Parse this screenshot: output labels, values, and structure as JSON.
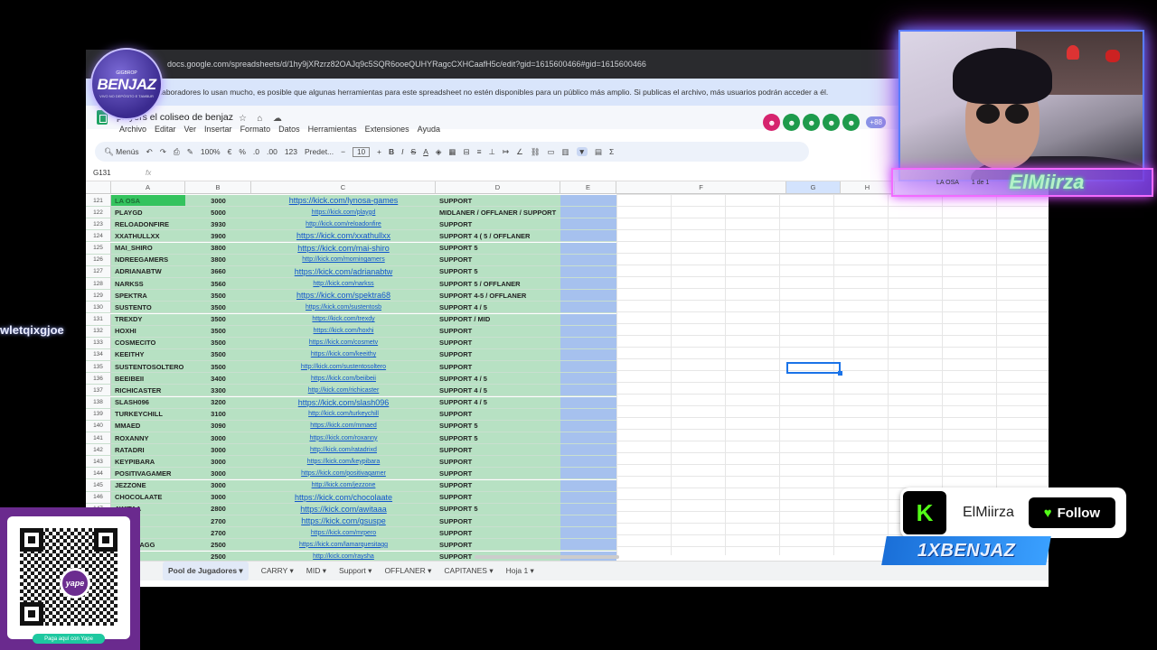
{
  "browser": {
    "url": "docs.google.com/spreadsheets/d/1hy9jXRzrz82OAJq9c5SQR6ooeQUHYRagcCXHCaafH5c/edit?gid=1615600466#gid=1615600466",
    "notice": "los colaboradores lo usan mucho, es posible que algunas herramientas para este spreadsheet no estén disponibles para un público más amplio. Si publicas el archivo, más usuarios podrán acceder a él."
  },
  "doc": {
    "title": "players el coliseo de benjaz",
    "menus": [
      "Archivo",
      "Editar",
      "Ver",
      "Insertar",
      "Formato",
      "Datos",
      "Herramientas",
      "Extensiones",
      "Ayuda"
    ],
    "collaborators_more": "+88"
  },
  "toolbar": {
    "search": "Menús",
    "zoom": "100%",
    "currency": "€",
    "percent": "%",
    "dec_less": ".0",
    "dec_more": ".00",
    "number_fmt": "123",
    "font": "Predet...",
    "font_size": "10"
  },
  "formula_bar": {
    "cell_ref": "G131",
    "fx": "fx"
  },
  "columns": [
    "A",
    "B",
    "C",
    "D",
    "E",
    "F",
    "G",
    "H"
  ],
  "rows": [
    {
      "n": "121",
      "a": "LA OSA",
      "b": "3000",
      "c": "https://kick.com/lynosa-games",
      "d": "SUPPORT"
    },
    {
      "n": "122",
      "a": "PLAYGD",
      "b": "5000",
      "c": "https://kick.com/playgd",
      "d": "MIDLANER / OFFLANER / SUPPORT"
    },
    {
      "n": "123",
      "a": "RELOADONFIRE",
      "b": "3930",
      "c": "http://kick.com/reloadonfire",
      "d": "SUPPORT"
    },
    {
      "n": "124",
      "a": "XXATHULLXX",
      "b": "3900",
      "c": "https://kick.com/xxathullxx",
      "d": "SUPPORT 4 ( 5 / OFFLANER"
    },
    {
      "n": "125",
      "a": "MAI_SHIRO",
      "b": "3800",
      "c": "https://kick.com/mai-shiro",
      "d": "SUPPORT 5"
    },
    {
      "n": "126",
      "a": "NDREEGAMERS",
      "b": "3800",
      "c": "http://kick.com/morningamers",
      "d": "SUPPORT"
    },
    {
      "n": "127",
      "a": "ADRIANABTW",
      "b": "3660",
      "c": "https://kick.com/adrianabtw",
      "d": "SUPPORT 5"
    },
    {
      "n": "128",
      "a": "NARKSS",
      "b": "3560",
      "c": "http://kick.com/narkss",
      "d": "SUPPORT 5 / OFFLANER"
    },
    {
      "n": "129",
      "a": "SPEKTRA",
      "b": "3500",
      "c": "https://kick.com/spektra68",
      "d": "SUPPORT 4-5 / OFFLANER"
    },
    {
      "n": "130",
      "a": "SUSTENTO",
      "b": "3500",
      "c": "https://kick.com/sustentosb",
      "d": "SUPPORT 4 / 5"
    },
    {
      "n": "131",
      "a": "TREXDY",
      "b": "3500",
      "c": "https://kick.com/trexdy",
      "d": "SUPPORT / MID"
    },
    {
      "n": "132",
      "a": "HOXHI",
      "b": "3500",
      "c": "https://kick.com/hoxhi",
      "d": "SUPPORT"
    },
    {
      "n": "133",
      "a": "COSMECITO",
      "b": "3500",
      "c": "https://kick.com/cosmetv",
      "d": "SUPPORT"
    },
    {
      "n": "134",
      "a": "KEEITHY",
      "b": "3500",
      "c": "https://kick.com/keeithy",
      "d": "SUPPORT"
    },
    {
      "n": "135",
      "a": "SUSTENTOSOLTERO",
      "b": "3500",
      "c": "http://kick.com/sustentosoltero",
      "d": "SUPPORT"
    },
    {
      "n": "136",
      "a": "BEEIBEII",
      "b": "3400",
      "c": "https://kick.com/beiibeii",
      "d": "SUPPORT 4 / 5"
    },
    {
      "n": "137",
      "a": "RICHICASTER",
      "b": "3300",
      "c": "http://kick.com/richicaster",
      "d": "SUPPORT 4 / 5"
    },
    {
      "n": "138",
      "a": "SLASH096",
      "b": "3200",
      "c": "https://kick.com/slash096",
      "d": "SUPPORT 4 / 5"
    },
    {
      "n": "139",
      "a": "TURKEYCHILL",
      "b": "3100",
      "c": "http://kick.com/turkeychill",
      "d": "SUPPORT"
    },
    {
      "n": "140",
      "a": "MMAED",
      "b": "3090",
      "c": "https://kick.com/mmaed",
      "d": "SUPPORT 5"
    },
    {
      "n": "141",
      "a": "ROXANNY",
      "b": "3000",
      "c": "https://kick.com/roxanny",
      "d": "SUPPORT 5"
    },
    {
      "n": "142",
      "a": "RATADRI",
      "b": "3000",
      "c": "http://kick.com/ratadrixd",
      "d": "SUPPORT"
    },
    {
      "n": "143",
      "a": "KEYPIBARA",
      "b": "3000",
      "c": "https://kick.com/keypibara",
      "d": "SUPPORT"
    },
    {
      "n": "144",
      "a": "POSITIVAGAMER",
      "b": "3000",
      "c": "https://kick.com/positivagamer",
      "d": "SUPPORT"
    },
    {
      "n": "145",
      "a": "JEZZONE",
      "b": "3000",
      "c": "http://kick.com/jezzone",
      "d": "SUPPORT"
    },
    {
      "n": "146",
      "a": "CHOCOLAATE",
      "b": "3000",
      "c": "https://kick.com/chocolaate",
      "d": "SUPPORT"
    },
    {
      "n": "147",
      "a": "AWITAA",
      "b": "2800",
      "c": "https://kick.com/awitaaa",
      "d": "SUPPORT 5"
    },
    {
      "n": "148",
      "a": "",
      "b": "2700",
      "c": "https://kick.com/gsuspe",
      "d": "SUPPORT"
    },
    {
      "n": "149",
      "a": "RO",
      "b": "2700",
      "c": "https://kick.com/mrpero",
      "d": "SUPPORT"
    },
    {
      "n": "150",
      "a": "QUESITAGG",
      "b": "2500",
      "c": "https://kick.com/lamarquesitagg",
      "d": "SUPPORT"
    },
    {
      "n": "151",
      "a": "",
      "b": "2500",
      "c": "http://kick.com/raysha",
      "d": "SUPPORT"
    }
  ],
  "sheet_tabs": [
    "Pool de Jugadores",
    "CARRY",
    "MID",
    "Support",
    "OFFLANER",
    "CAPITANES",
    "Hoja 1"
  ],
  "overlay": {
    "logo_top": "GIGBROP",
    "logo_name": "BENJAZ",
    "logo_sub": "VIVO NO DEPÓSITO E TAMBUR",
    "name_banner": "ElMiirza",
    "name_banner_meta1": "LA OSA",
    "name_banner_meta2": "1 de 1",
    "side_text": "wletqixgjoe",
    "qr_logo": "yape",
    "qr_caption": "Paga aquí con Yape",
    "kick_name": "ElMiirza",
    "follow_label": "Follow",
    "kick_letter": "K",
    "sponsor": "1XBENJAZ"
  },
  "colors": {
    "accent_green": "#53fc18",
    "cell_green": "#b7e1c3",
    "col_e_blue": "#a6c1ee",
    "link_blue": "#1155cc"
  }
}
